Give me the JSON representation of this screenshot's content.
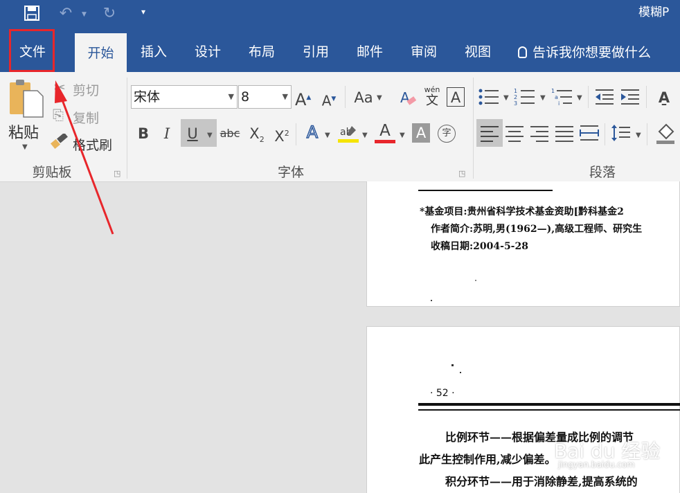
{
  "window": {
    "title": "模糊P"
  },
  "quick_access": {
    "save_icon": "save-icon",
    "undo_icon": "undo-icon",
    "redo_icon": "redo-icon",
    "customize_icon": "customize-qat-icon"
  },
  "tabs": [
    {
      "label": "文件"
    },
    {
      "label": "开始"
    },
    {
      "label": "插入"
    },
    {
      "label": "设计"
    },
    {
      "label": "布局"
    },
    {
      "label": "引用"
    },
    {
      "label": "邮件"
    },
    {
      "label": "审阅"
    },
    {
      "label": "视图"
    }
  ],
  "tell_me": {
    "text": "告诉我你想要做什么",
    "icon": "lightbulb-icon"
  },
  "clipboard": {
    "paste_label": "粘贴",
    "cut_label": "剪切",
    "copy_label": "复制",
    "format_painter_label": "格式刷",
    "group_label": "剪贴板"
  },
  "font": {
    "font_name": "宋体",
    "font_size": "8",
    "case_label": "Aa",
    "phonetic_label": "wén",
    "phonetic_char": "文",
    "border_char": "A",
    "group_label": "字体",
    "bold": "B",
    "italic": "I",
    "underline": "U",
    "strike": "abc",
    "subscript": "X",
    "superscript": "X",
    "sub_mark": "2",
    "sup_mark": "2",
    "grow": "A",
    "shrink": "A",
    "highlight_color": "#f5e400",
    "font_color": "#e8262b",
    "enclose_char": "字"
  },
  "paragraph": {
    "group_label": "段落"
  },
  "document": {
    "page1": {
      "line1": "*基金项目:贵州省科学技术基金资助[黔科基金2",
      "line2": "作者简介:苏明,男(1962—),高级工程师、研究生",
      "line3": "收稿日期:2004-5-28"
    },
    "page2": {
      "page_num": "· 52 ·",
      "para1_line1": "比例环节——根据偏差量成比例的调节",
      "para1_line2": "此产生控制作用,减少偏差。",
      "para2_line1": "积分环节——用于消除静差,提高系统的"
    }
  },
  "watermark": {
    "text": "Bai du 经验",
    "url": "jingyan.baidu.com"
  },
  "accent_colors": {
    "title_bar": "#2b579a",
    "ribbon": "#f3f3f3",
    "highlight_box": "#e8262b",
    "arrow": "#e8262b"
  }
}
